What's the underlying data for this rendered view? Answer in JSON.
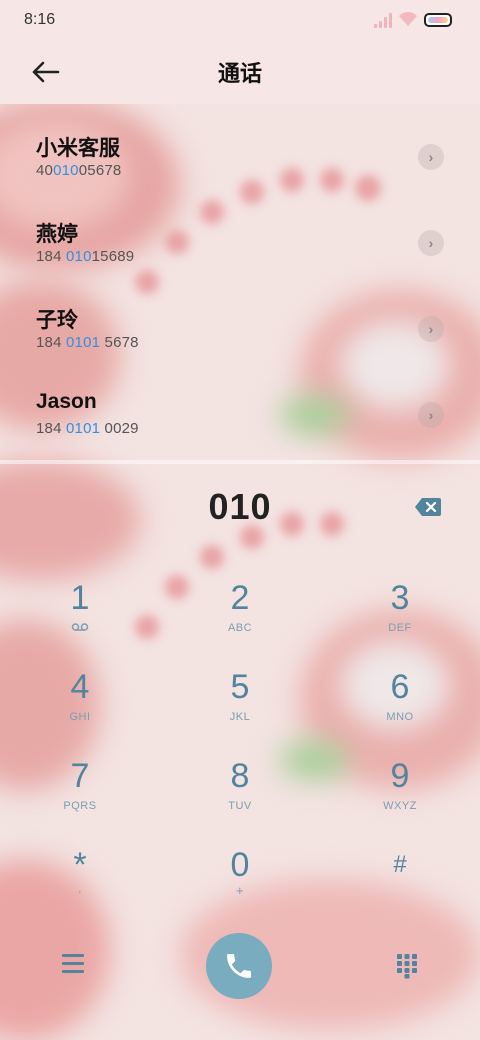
{
  "status_bar": {
    "time": "8:16"
  },
  "header": {
    "title": "通话",
    "back_icon": "back-arrow-icon"
  },
  "results": [
    {
      "name": "小米客服",
      "number_prefix": "40",
      "number_match": "010",
      "number_suffix": "05678"
    },
    {
      "name": "燕婷",
      "number_prefix": "184 ",
      "number_match": "010",
      "number_suffix": "15689"
    },
    {
      "name": "子玲",
      "number_prefix": "184 ",
      "number_match": "0101",
      "number_suffix": " 5678"
    },
    {
      "name": "Jason",
      "number_prefix": "184 ",
      "number_match": "0101",
      "number_suffix": " 0029"
    }
  ],
  "dialer": {
    "input_value": "010",
    "delete_icon": "backspace-icon"
  },
  "keypad": [
    {
      "digit": "1",
      "sub": ""
    },
    {
      "digit": "2",
      "sub": "ABC"
    },
    {
      "digit": "3",
      "sub": "DEF"
    },
    {
      "digit": "4",
      "sub": "GHI"
    },
    {
      "digit": "5",
      "sub": "JKL"
    },
    {
      "digit": "6",
      "sub": "MNO"
    },
    {
      "digit": "7",
      "sub": "PQRS"
    },
    {
      "digit": "8",
      "sub": "TUV"
    },
    {
      "digit": "9",
      "sub": "WXYZ"
    },
    {
      "digit": "*",
      "sub": ","
    },
    {
      "digit": "0",
      "sub": "+"
    },
    {
      "digit": "#",
      "sub": ""
    }
  ],
  "actions": {
    "menu_icon": "menu-icon",
    "call_icon": "phone-icon",
    "keypad_icon": "dialpad-icon"
  },
  "colors": {
    "accent": "#52849e",
    "highlight": "#3390e0",
    "call_button": "#79acbe"
  }
}
